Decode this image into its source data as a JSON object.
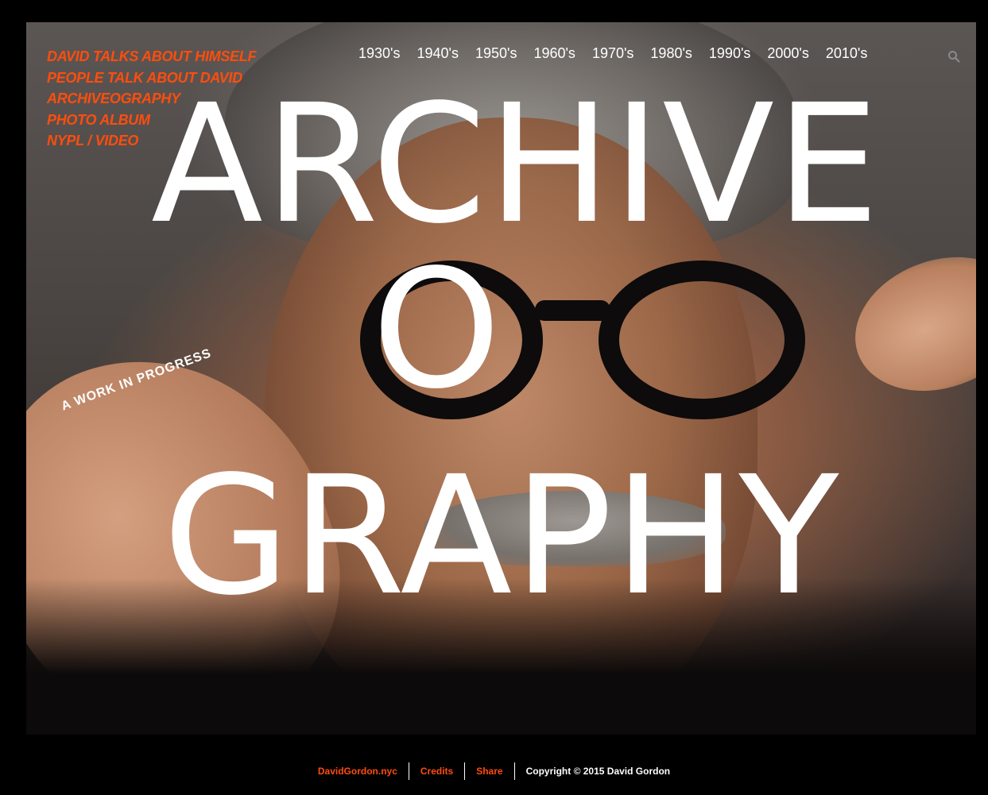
{
  "left_nav": {
    "items": [
      "DAVID TALKS ABOUT HIMSELF",
      "PEOPLE TALK ABOUT DAVID",
      "ARCHIVEOGRAPHY",
      "PHOTO ALBUM",
      "NYPL / VIDEO"
    ]
  },
  "decade_nav": {
    "items": [
      "1930's",
      "1940's",
      "1950's",
      "1960's",
      "1970's",
      "1980's",
      "1990's",
      "2000's",
      "2010's"
    ]
  },
  "search": {
    "icon": "search-icon"
  },
  "hero": {
    "title_line1": "ARCHIVE",
    "title_line2": "O",
    "title_line3": "GRAPHY",
    "tagline": "A WORK IN PROGRESS"
  },
  "footer": {
    "link1": "DavidGordon.nyc",
    "link2": "Credits",
    "link3": "Share",
    "copyright": "Copyright © 2015 David Gordon"
  },
  "colors": {
    "accent": "#ff4d0d",
    "text": "#ffffff",
    "background": "#000000"
  }
}
